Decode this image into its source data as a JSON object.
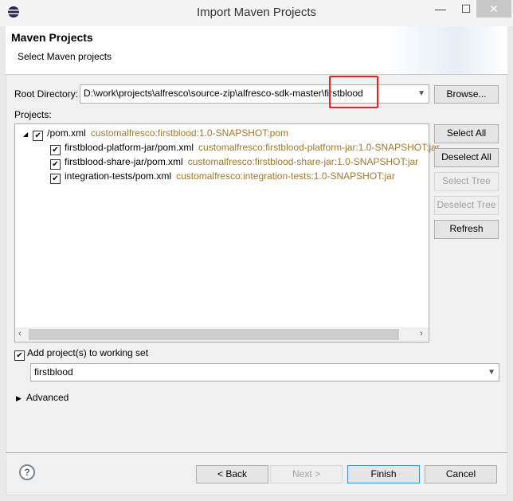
{
  "window": {
    "title": "Import Maven Projects",
    "minimize": "—",
    "maximize": "☐",
    "close": "✕"
  },
  "header": {
    "title": "Maven Projects",
    "subtitle": "Select Maven projects"
  },
  "root": {
    "label": "Root Directory:",
    "value_prefix": "D:\\work\\projects\\alfresco\\source-zip\\alfresco-sdk-master\\",
    "value_highlight": "firstblood",
    "browse": "Browse..."
  },
  "projects": {
    "label": "Projects:",
    "items": [
      {
        "path": "/pom.xml",
        "gav": "customalfresco:firstblood:1.0-SNAPSHOT:pom",
        "checked": true
      },
      {
        "path": "firstblood-platform-jar/pom.xml",
        "gav": "customalfresco:firstblood-platform-jar:1.0-SNAPSHOT:jar",
        "checked": true
      },
      {
        "path": "firstblood-share-jar/pom.xml",
        "gav": "customalfresco:firstblood-share-jar:1.0-SNAPSHOT:jar",
        "checked": true
      },
      {
        "path": "integration-tests/pom.xml",
        "gav": "customalfresco:integration-tests:1.0-SNAPSHOT:jar",
        "checked": true
      }
    ]
  },
  "side_buttons": {
    "select_all": "Select All",
    "deselect_all": "Deselect All",
    "select_tree": "Select Tree",
    "deselect_tree": "Deselect Tree",
    "refresh": "Refresh"
  },
  "working_set": {
    "label": "Add project(s) to working set",
    "checked": true,
    "value": "firstblood"
  },
  "advanced": "Advanced",
  "footer": {
    "back": "< Back",
    "next": "Next >",
    "finish": "Finish",
    "cancel": "Cancel"
  },
  "colors": {
    "highlight": "#e8221b",
    "gav": "#a0782c"
  }
}
